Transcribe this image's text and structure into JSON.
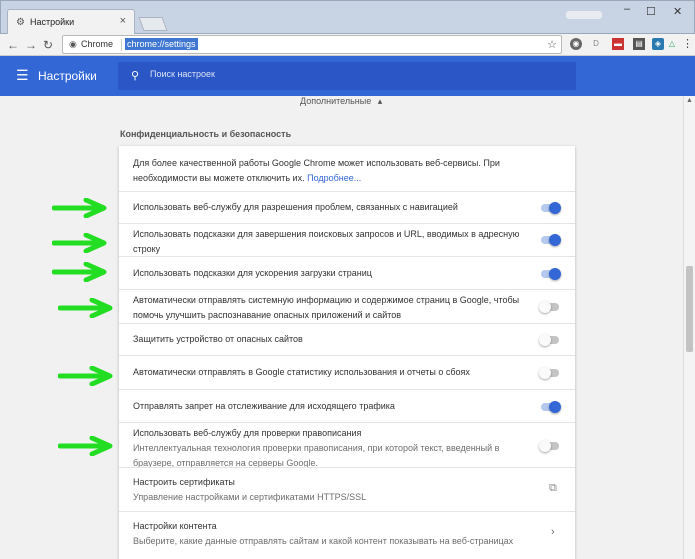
{
  "browser": {
    "tab_title": "Настройки",
    "omnibox_label": "Chrome",
    "omnibox_url": "chrome://settings"
  },
  "app": {
    "title": "Настройки",
    "search_placeholder": "Поиск настроек"
  },
  "advanced_label": "Дополнительные",
  "section_title": "Конфиденциальность и безопасность",
  "intro": {
    "text": "Для более качественной работы Google Chrome может использовать веб-сервисы. При необходимости вы можете отключить их.",
    "link": "Подробнее..."
  },
  "settings": [
    {
      "label": "Использовать веб-службу для разрешения проблем, связанных с навигацией",
      "state": "on"
    },
    {
      "label": "Использовать подсказки для завершения поисковых запросов и URL, вводимых в адресную строку",
      "state": "on"
    },
    {
      "label": "Использовать подсказки для ускорения загрузки страниц",
      "state": "on"
    },
    {
      "label": "Автоматически отправлять системную информацию и содержимое страниц в Google, чтобы помочь улучшить распознавание опасных приложений и сайтов",
      "state": "off"
    },
    {
      "label": "Защитить устройство от опасных сайтов",
      "state": "off"
    },
    {
      "label": "Автоматически отправлять в Google статистику использования и отчеты о сбоях",
      "state": "off"
    },
    {
      "label": "Отправлять запрет на отслеживание для исходящего трафика",
      "state": "on"
    },
    {
      "label": "Использовать веб-службу для проверки правописания",
      "sub": "Интеллектуальная технология проверки правописания, при которой текст, введенный в браузере, отправляется на серверы Google.",
      "state": "off"
    }
  ],
  "certificates": {
    "title": "Настроить сертификаты",
    "sub": "Управление настройками и сертификатами HTTPS/SSL"
  },
  "content_settings": {
    "title": "Настройки контента",
    "sub": "Выберите, какие данные отправлять сайтам и какой контент показывать на веб-страницах"
  },
  "colors": {
    "accent": "#3367d6",
    "arrow": "#22dd22"
  },
  "icons": {
    "tab": "gear-icon",
    "search": "search-icon",
    "menu": "hamburger-icon",
    "certificates": "launch-icon",
    "content": "chevron-right-icon"
  }
}
